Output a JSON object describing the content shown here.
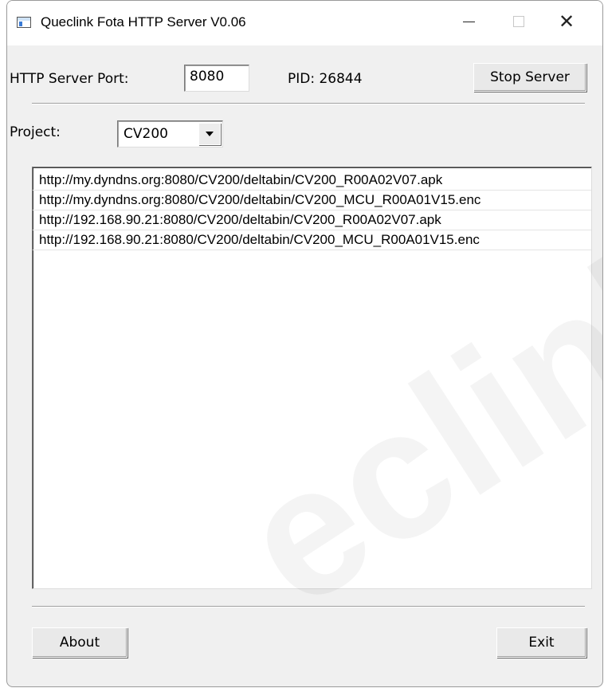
{
  "window": {
    "title": "Queclink Fota HTTP Server V0.06"
  },
  "server": {
    "port_label": "HTTP Server Port:",
    "port_value": "8080",
    "pid_label": "PID: 26844",
    "stop_button": "Stop Server"
  },
  "project": {
    "label": "Project:",
    "selected": "CV200"
  },
  "urls": [
    "http://my.dyndns.org:8080/CV200/deltabin/CV200_R00A02V07.apk",
    "http://my.dyndns.org:8080/CV200/deltabin/CV200_MCU_R00A01V15.enc",
    "http://192.168.90.21:8080/CV200/deltabin/CV200_R00A02V07.apk",
    "http://192.168.90.21:8080/CV200/deltabin/CV200_MCU_R00A01V15.enc"
  ],
  "footer": {
    "about_button": "About",
    "exit_button": "Exit"
  },
  "watermark": "eclink",
  "icons": {
    "app": "app-window-icon",
    "minimize": "minimize-icon",
    "maximize": "maximize-icon",
    "close": "close-icon",
    "dropdown": "chevron-down-icon"
  }
}
